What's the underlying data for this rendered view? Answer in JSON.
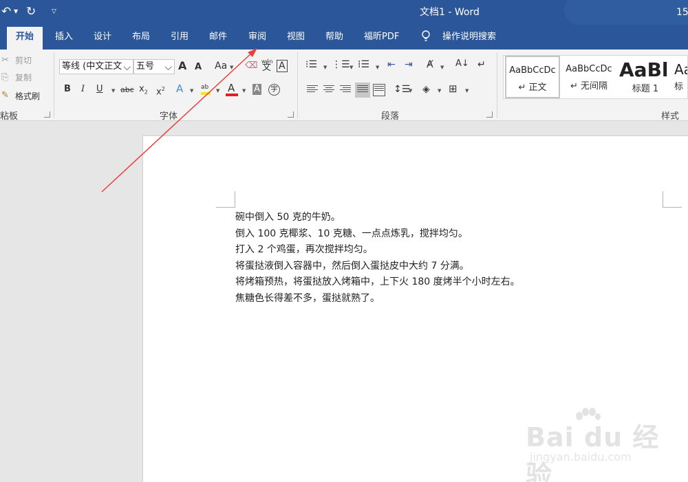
{
  "titlebar": {
    "title": "文档1 - Word",
    "right_text": "15",
    "undo_icon": "undo-icon",
    "redo_icon": "redo-icon",
    "customize_icon": "customize-qat-icon",
    "colors": {
      "bar": "#2b579a"
    }
  },
  "tabs": [
    {
      "label": "开始",
      "active": true
    },
    {
      "label": "插入"
    },
    {
      "label": "设计"
    },
    {
      "label": "布局"
    },
    {
      "label": "引用"
    },
    {
      "label": "邮件"
    },
    {
      "label": "审阅"
    },
    {
      "label": "视图"
    },
    {
      "label": "帮助"
    },
    {
      "label": "福昕PDF"
    }
  ],
  "tell_me": {
    "label": "操作说明搜索",
    "icon": "lightbulb-icon"
  },
  "clipboard": {
    "cut": "剪切",
    "copy": "复制",
    "format_painter": "格式刷",
    "group_label": "粘板"
  },
  "font": {
    "font_name": "等线 (中文正文",
    "font_size": "五号",
    "grow": "A",
    "shrink": "A",
    "change_case": "Aa",
    "phonetic_top": "wén",
    "phonetic_bottom": "文",
    "char_border": "A",
    "bold": "B",
    "italic": "I",
    "underline": "U",
    "strike": "abc",
    "subscript": "x",
    "subscript_index": "2",
    "superscript": "x",
    "superscript_index": "2",
    "text_effects": "A",
    "highlight": "ab",
    "font_color": "A",
    "char_shading": "A",
    "enclose": "字",
    "group_label": "字体"
  },
  "paragraph": {
    "group_label": "段落"
  },
  "styles": {
    "items": [
      {
        "sample": "AaBbCcDc",
        "name": "↵ 正文"
      },
      {
        "sample": "AaBbCcDc",
        "name": "↵ 无间隔"
      },
      {
        "sample": "AaBl",
        "name": "标题 1"
      },
      {
        "sample": "Aa",
        "name": "标"
      }
    ],
    "group_label": "样式"
  },
  "document": {
    "lines": [
      "碗中倒入 50 克的牛奶。",
      "倒入 100 克椰浆、10 克糖、一点点炼乳，搅拌均匀。",
      "打入 2 个鸡蛋，再次搅拌均匀。",
      "将蛋挞液倒入容器中，然后倒入蛋挞皮中大约 7 分满。",
      "将烤箱预热，将蛋挞放入烤箱中，上下火 180 度烤半个小时左右。",
      "焦糖色长得差不多，蛋挞就熟了。"
    ]
  },
  "watermark": {
    "main": "Bai du 经验",
    "sub": "jingyan.baidu.com"
  },
  "annotation": {
    "color": "#e8403c"
  }
}
